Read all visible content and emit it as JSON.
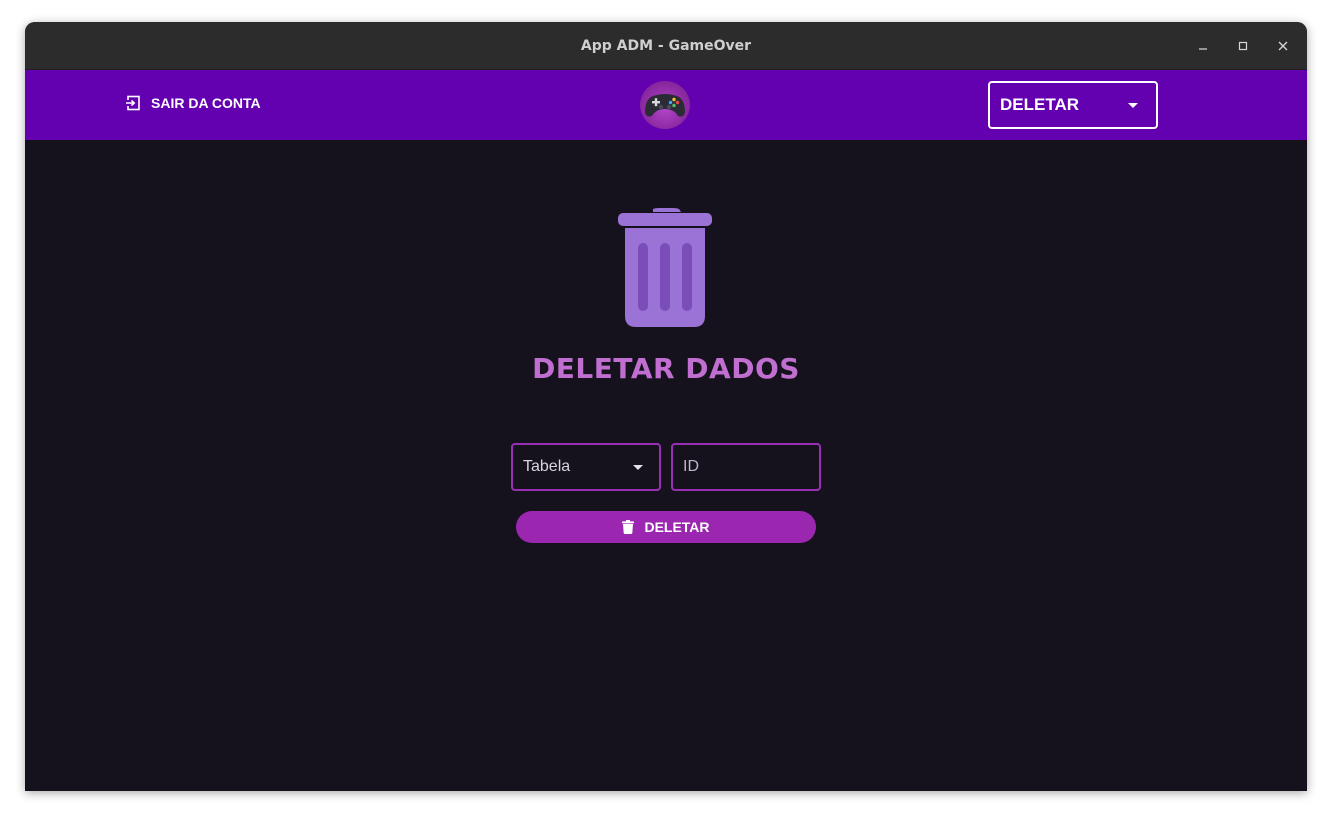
{
  "window": {
    "title": "App ADM - GameOver",
    "controls": [
      "minimize",
      "maximize",
      "close"
    ]
  },
  "appbar": {
    "logout_label": "SAIR DA CONTA",
    "logout_icon": "logout-icon",
    "logo_icon": "gamepad-logo-icon",
    "mode_select_value": "DELETAR",
    "background": "#6300b0"
  },
  "main": {
    "icon": "trash-icon",
    "heading": "DELETAR DADOS",
    "table_select_value": "Tabela",
    "id_placeholder": "ID",
    "delete_button_label": "DELETAR",
    "accent": "#9b27b0",
    "heading_color": "#c06ed0",
    "background": "#16121d"
  }
}
